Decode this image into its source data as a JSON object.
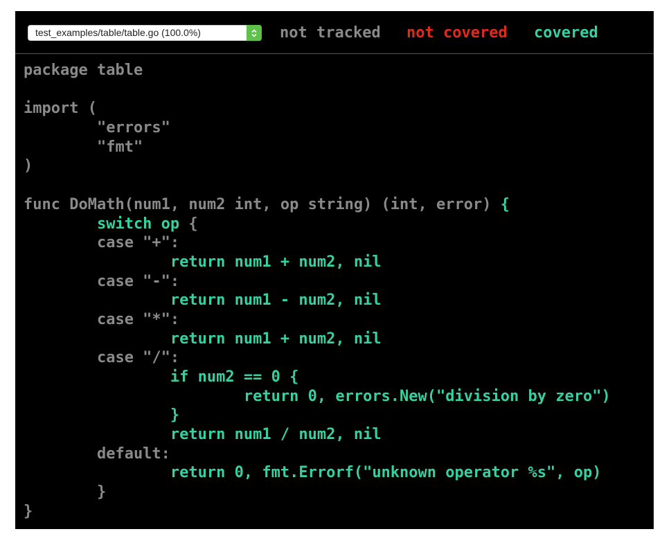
{
  "file_select": {
    "value": "test_examples/table/table.go (100.0%)"
  },
  "legend": {
    "not_tracked": "not tracked",
    "not_covered": "not covered",
    "covered": "covered"
  },
  "colors": {
    "background": "#000000",
    "not_tracked": "#8a8a8a",
    "not_covered": "#e02a1c",
    "covered": "#37d0a0",
    "stepper": "#5dc14a"
  },
  "code_lines": [
    [
      {
        "t": "package table",
        "c": "nt"
      }
    ],
    [],
    [
      {
        "t": "import (",
        "c": "nt"
      }
    ],
    [
      {
        "t": "        \"errors\"",
        "c": "nt"
      }
    ],
    [
      {
        "t": "        \"fmt\"",
        "c": "nt"
      }
    ],
    [
      {
        "t": ")",
        "c": "nt"
      }
    ],
    [],
    [
      {
        "t": "func DoMath(num1, num2 int, op string) (int, error) ",
        "c": "nt"
      },
      {
        "t": "{",
        "c": "cv"
      }
    ],
    [
      {
        "t": "        switch op ",
        "c": "cv"
      },
      {
        "t": "{",
        "c": "nt"
      }
    ],
    [
      {
        "t": "        case \"+\":",
        "c": "nt"
      }
    ],
    [
      {
        "t": "                return num1 + num2, nil",
        "c": "cv"
      }
    ],
    [
      {
        "t": "        case \"-\":",
        "c": "nt"
      }
    ],
    [
      {
        "t": "                return num1 - num2, nil",
        "c": "cv"
      }
    ],
    [
      {
        "t": "        case \"*\":",
        "c": "nt"
      }
    ],
    [
      {
        "t": "                return num1 + num2, nil",
        "c": "cv"
      }
    ],
    [
      {
        "t": "        case \"/\":",
        "c": "nt"
      }
    ],
    [
      {
        "t": "                if num2 == 0 {",
        "c": "cv"
      }
    ],
    [
      {
        "t": "                        return 0, errors.New(\"division by zero\")",
        "c": "cv"
      }
    ],
    [
      {
        "t": "                }",
        "c": "cv"
      }
    ],
    [
      {
        "t": "                return num1 / num2, nil",
        "c": "cv"
      }
    ],
    [
      {
        "t": "        default:",
        "c": "nt"
      }
    ],
    [
      {
        "t": "                return 0, fmt.Errorf(\"unknown operator %s\", op)",
        "c": "cv"
      }
    ],
    [
      {
        "t": "        }",
        "c": "nt"
      }
    ],
    [
      {
        "t": "}",
        "c": "nt"
      }
    ]
  ]
}
